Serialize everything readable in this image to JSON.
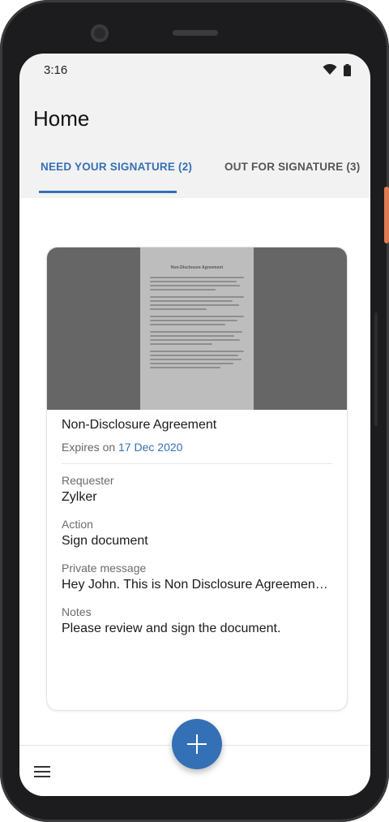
{
  "status_bar": {
    "time": "3:16"
  },
  "header": {
    "title": "Home"
  },
  "tabs": [
    {
      "label": "NEED YOUR SIGNATURE (2)"
    },
    {
      "label": "OUT FOR SIGNATURE (3)"
    }
  ],
  "card": {
    "preview_title": "Non-Disclosure Agreement",
    "document_name": "Non-Disclosure Agreement",
    "expires_prefix": "Expires on",
    "expires_date": "17 Dec 2020",
    "fields": [
      {
        "label": "Requester",
        "value": "Zylker"
      },
      {
        "label": "Action",
        "value": "Sign document"
      },
      {
        "label": "Private message",
        "value": "Hey John. This is Non Disclosure Agreemen…"
      },
      {
        "label": "Notes",
        "value": "Please review and sign the document."
      }
    ]
  },
  "icons": {
    "wifi": "wifi-icon",
    "battery": "battery-icon",
    "menu": "hamburger-menu-icon",
    "add": "plus-icon"
  },
  "colors": {
    "accent": "#3470b5",
    "device_frame": "#1c1c1e",
    "power_button": "#e07a4f"
  }
}
